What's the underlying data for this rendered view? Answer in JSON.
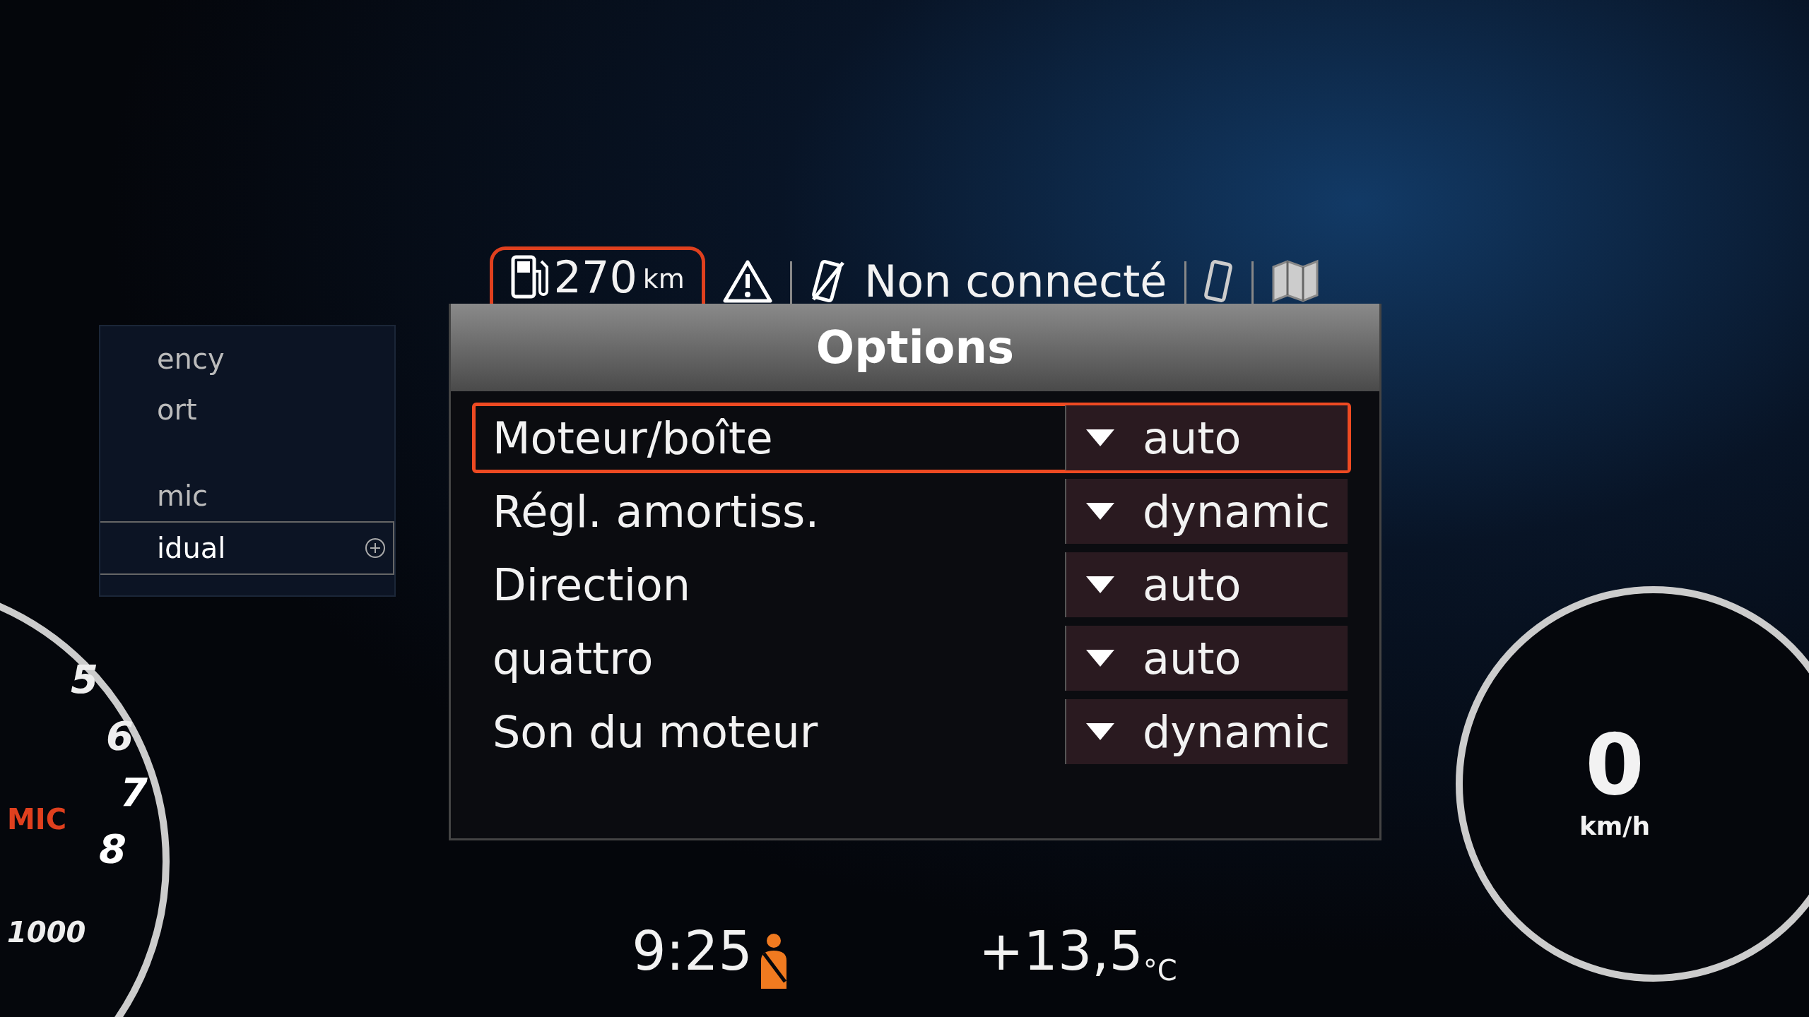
{
  "status_bar": {
    "range": "270",
    "range_unit": "km",
    "connection": "Non connecté"
  },
  "side_menu": {
    "items": [
      {
        "label": "ency",
        "selected": false
      },
      {
        "label": "ort",
        "selected": false
      },
      {
        "label": "mic",
        "selected": false
      },
      {
        "label": "idual",
        "selected": true
      }
    ]
  },
  "options": {
    "title": "Options",
    "rows": [
      {
        "label": "Moteur/boîte",
        "value": "auto",
        "selected": true
      },
      {
        "label": "Régl. amortiss.",
        "value": "dynamic",
        "selected": false
      },
      {
        "label": "Direction",
        "value": "auto",
        "selected": false
      },
      {
        "label": "quattro",
        "value": "auto",
        "selected": false
      },
      {
        "label": "Son du moteur",
        "value": "dynamic",
        "selected": false
      }
    ]
  },
  "tachometer": {
    "numbers": [
      "5",
      "6",
      "7",
      "8"
    ],
    "scale": "1000",
    "mode": "MIC"
  },
  "speedometer": {
    "speed": "0",
    "unit": "km/h"
  },
  "bottom_bar": {
    "time": "9:25",
    "temperature": "+13,5",
    "temperature_unit": "°C"
  }
}
